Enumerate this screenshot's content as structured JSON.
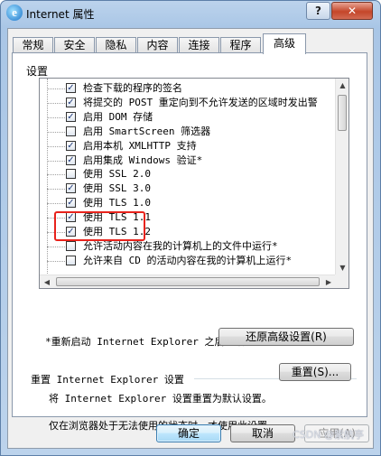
{
  "window": {
    "title": "Internet 属性",
    "help_label": "?",
    "close_label": "✕",
    "icon": "internet-explorer-icon"
  },
  "tabs": [
    {
      "label": "常规",
      "active": false
    },
    {
      "label": "安全",
      "active": false
    },
    {
      "label": "隐私",
      "active": false
    },
    {
      "label": "内容",
      "active": false
    },
    {
      "label": "连接",
      "active": false
    },
    {
      "label": "程序",
      "active": false
    },
    {
      "label": "高级",
      "active": true
    }
  ],
  "settings": {
    "group_label": "设置",
    "items": [
      {
        "label": "检查下载的程序的签名",
        "checked": true
      },
      {
        "label": "将提交的 POST 重定向到不允许发送的区域时发出警",
        "checked": true
      },
      {
        "label": "启用 DOM 存储",
        "checked": true
      },
      {
        "label": "启用 SmartScreen 筛选器",
        "checked": false
      },
      {
        "label": "启用本机 XMLHTTP 支持",
        "checked": true
      },
      {
        "label": "启用集成 Windows 验证*",
        "checked": true
      },
      {
        "label": "使用 SSL 2.0",
        "checked": false
      },
      {
        "label": "使用 SSL 3.0",
        "checked": true
      },
      {
        "label": "使用 TLS 1.0",
        "checked": true
      },
      {
        "label": "使用 TLS 1.1",
        "checked": true
      },
      {
        "label": "使用 TLS 1.2",
        "checked": true
      },
      {
        "label": "允许活动内容在我的计算机上的文件中运行*",
        "checked": false
      },
      {
        "label": "允许来自 CD 的活动内容在我的计算机上运行*",
        "checked": false
      }
    ],
    "scroll_up": "▲",
    "scroll_down": "▼",
    "scroll_left": "◀",
    "scroll_right": "▶"
  },
  "restart_note": "*重新启动 Internet Explorer 之后生效",
  "restore_button": "还原高级设置(R)",
  "reset": {
    "title": "重置 Internet Explorer 设置",
    "description": "将 Internet Explorer 设置重置为默认设置。",
    "button": "重置(S)...",
    "hint": "仅在浏览器处于无法使用的状态时，才使用此设置。"
  },
  "footer": {
    "ok": "确定",
    "cancel": "取消",
    "apply": "应用(A)"
  },
  "watermark": "CSDN @紫航亭",
  "colors": {
    "highlight": "#e8231c",
    "close_button": "#c4462a"
  }
}
